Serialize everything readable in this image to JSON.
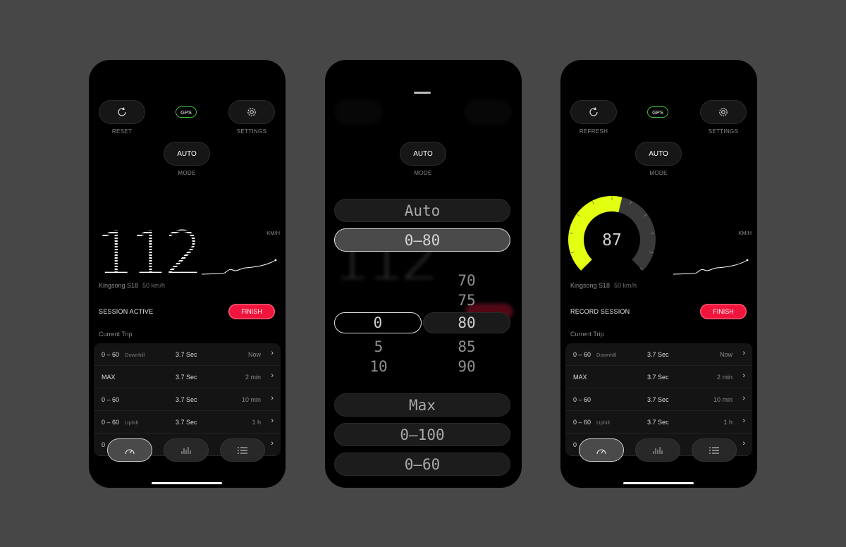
{
  "colors": {
    "background": "#474747",
    "accent_red": "#f0153c",
    "gps_green": "#3ec33e",
    "gauge_yellow": "#e3ff12"
  },
  "screen1": {
    "reset_label": "RESET",
    "gps": "GPS",
    "settings_label": "SETTINGS",
    "mode_value": "AUTO",
    "mode_label": "MODE",
    "speed": "112",
    "unit": "KM/H",
    "device_name": "Kingsong S18",
    "device_speed": "50 km/h",
    "session_label": "SESSION ACTIVE",
    "finish": "FINISH",
    "trip_title": "Current Trip",
    "trips": [
      {
        "name": "0 – 60",
        "tag": "Downhill",
        "time": "3.7 Sec",
        "ago": "Now"
      },
      {
        "name": "MAX",
        "tag": "",
        "time": "3.7 Sec",
        "ago": "2 min"
      },
      {
        "name": "0 – 60",
        "tag": "",
        "time": "3.7 Sec",
        "ago": "10 min"
      },
      {
        "name": "0 – 60",
        "tag": "Uphill",
        "time": "3.7 Sec",
        "ago": "1 h"
      },
      {
        "name": "0",
        "tag": "",
        "time": "",
        "ago": ""
      }
    ],
    "icons": [
      "refresh-icon",
      "gear-icon",
      "speedometer-icon",
      "bar-chart-icon",
      "list-icon"
    ]
  },
  "screen2": {
    "mode_value": "AUTO",
    "mode_label": "MODE",
    "options_top": [
      "Auto",
      "0–80"
    ],
    "wheel_left": [
      "0",
      "5",
      "10"
    ],
    "wheel_right": [
      "70",
      "75",
      "80",
      "85",
      "90"
    ],
    "options_bottom": [
      "Max",
      "0–100",
      "0–60"
    ],
    "bg_speed": "112"
  },
  "screen3": {
    "refresh_label": "REFRESH",
    "gps": "GPS",
    "settings_label": "SETTINGS",
    "mode_value": "AUTO",
    "mode_label": "MODE",
    "gauge_value": "87",
    "gauge_level": 0.55,
    "unit": "KM/H",
    "device_name": "Kingsong S18",
    "device_speed": "50 km/h",
    "session_label": "RECORD SESSION",
    "finish": "FINISH",
    "trip_title": "Current Trip",
    "trips": [
      {
        "name": "0 – 60",
        "tag": "Downhill",
        "time": "3.7 Sec",
        "ago": "Now"
      },
      {
        "name": "MAX",
        "tag": "",
        "time": "3.7 Sec",
        "ago": "2 min"
      },
      {
        "name": "0 – 60",
        "tag": "",
        "time": "3.7 Sec",
        "ago": "10 min"
      },
      {
        "name": "0 – 60",
        "tag": "Uphill",
        "time": "3.7 Sec",
        "ago": "1 h"
      },
      {
        "name": "0",
        "tag": "",
        "time": "",
        "ago": ""
      }
    ]
  }
}
